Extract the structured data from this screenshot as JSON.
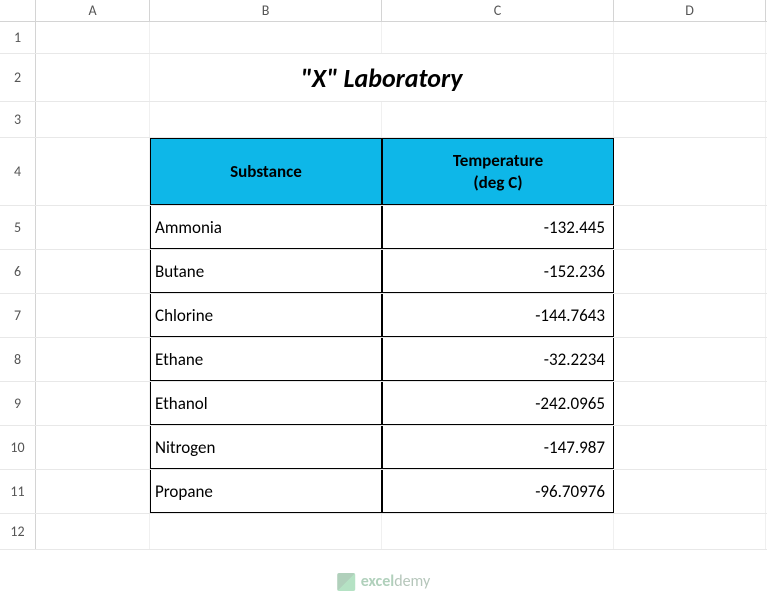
{
  "columns": {
    "A": "A",
    "B": "B",
    "C": "C",
    "D": "D"
  },
  "row_numbers": [
    "1",
    "2",
    "3",
    "4",
    "5",
    "6",
    "7",
    "8",
    "9",
    "10",
    "11",
    "12"
  ],
  "title": "\"X\" Laboratory",
  "table": {
    "headers": {
      "substance": "Substance",
      "temperature": "Temperature\n(deg C)"
    },
    "rows": [
      {
        "substance": "Ammonia",
        "temp": "-132.445"
      },
      {
        "substance": "Butane",
        "temp": "-152.236"
      },
      {
        "substance": "Chlorine",
        "temp": "-144.7643"
      },
      {
        "substance": "Ethane",
        "temp": "-32.2234"
      },
      {
        "substance": "Ethanol",
        "temp": "-242.0965"
      },
      {
        "substance": "Nitrogen",
        "temp": "-147.987"
      },
      {
        "substance": "Propane",
        "temp": "-96.70976"
      }
    ]
  },
  "watermark": {
    "brand": "excel",
    "suffix": "demy"
  },
  "chart_data": {
    "type": "table",
    "title": "\"X\" Laboratory",
    "columns": [
      "Substance",
      "Temperature (deg C)"
    ],
    "rows": [
      [
        "Ammonia",
        -132.445
      ],
      [
        "Butane",
        -152.236
      ],
      [
        "Chlorine",
        -144.7643
      ],
      [
        "Ethane",
        -32.2234
      ],
      [
        "Ethanol",
        -242.0965
      ],
      [
        "Nitrogen",
        -147.987
      ],
      [
        "Propane",
        -96.70976
      ]
    ]
  }
}
